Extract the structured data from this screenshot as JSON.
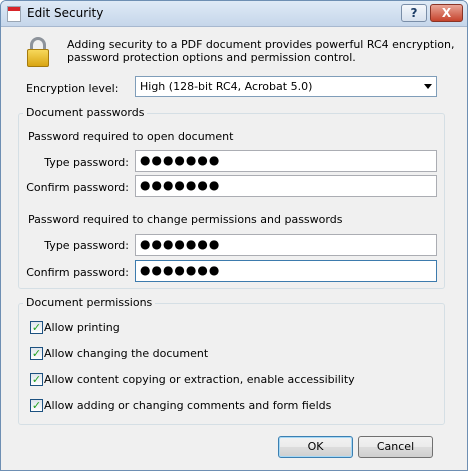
{
  "window": {
    "title": "Edit Security",
    "help_label": "?",
    "close_label": "X"
  },
  "intro": "Adding security to a PDF document provides powerful RC4 encryption, password protection options and permission control.",
  "encryption": {
    "label": "Encryption level:",
    "selected": "High (128-bit RC4, Acrobat 5.0)"
  },
  "passwords": {
    "legend": "Document passwords",
    "open": {
      "heading": "Password required to open document",
      "type_label": "Type password:",
      "type_value": "●●●●●●●",
      "confirm_label": "Confirm password:",
      "confirm_value": "●●●●●●●"
    },
    "permissions": {
      "heading": "Password required to change permissions and passwords",
      "type_label": "Type password:",
      "type_value": "●●●●●●●",
      "confirm_label": "Confirm password:",
      "confirm_value": "●●●●●●●"
    }
  },
  "permissions": {
    "legend": "Document permissions",
    "items": [
      {
        "label": "Allow printing",
        "checked": true
      },
      {
        "label": "Allow changing the document",
        "checked": true
      },
      {
        "label": "Allow content copying or extraction, enable accessibility",
        "checked": true
      },
      {
        "label": "Allow adding or changing comments and form fields",
        "checked": true
      }
    ]
  },
  "buttons": {
    "ok": "OK",
    "cancel": "Cancel"
  }
}
